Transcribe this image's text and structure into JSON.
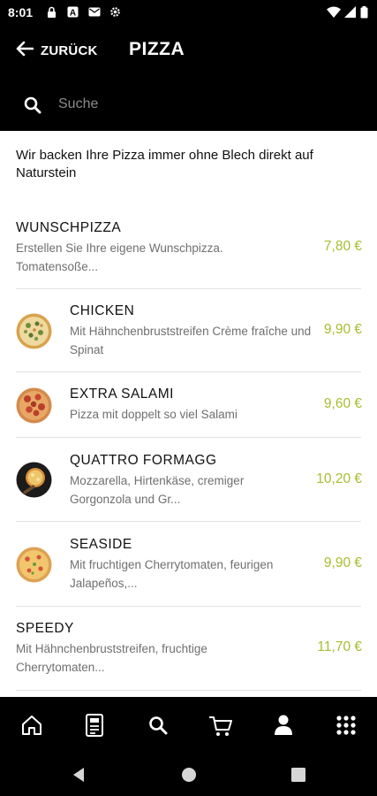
{
  "status_bar": {
    "time": "8:01",
    "left_icons": [
      "lock-icon",
      "a-icon",
      "mail-icon",
      "settings-icon"
    ],
    "right_icons": [
      "wifi-icon",
      "signal-icon",
      "battery-icon"
    ]
  },
  "header": {
    "back_label": "ZURÜCK",
    "title": "PIZZA"
  },
  "search": {
    "placeholder": "Suche"
  },
  "intro_text": "Wir backen Ihre Pizza immer ohne Blech direkt auf Naturstein",
  "items": [
    {
      "name": "WUNSCHPIZZA",
      "description": "Erstellen Sie Ihre eigene Wunschpizza. Tomatensoße...",
      "price": "7,80 €",
      "has_image": false
    },
    {
      "name": "CHICKEN",
      "description": "Mit Hähnchenbruststreifen Crème fraîche und Spinat",
      "price": "9,90 €",
      "has_image": true
    },
    {
      "name": "EXTRA SALAMI",
      "description": "Pizza mit doppelt so viel Salami",
      "price": "9,60 €",
      "has_image": true
    },
    {
      "name": "QUATTRO FORMAGG",
      "description": "Mozzarella, Hirtenkäse, cremiger Gorgonzola und Gr...",
      "price": "10,20 €",
      "has_image": true
    },
    {
      "name": "SEASIDE",
      "description": "Mit fruchtigen Cherrytomaten, feurigen Jalapeños,...",
      "price": "9,90 €",
      "has_image": true
    },
    {
      "name": "SPEEDY",
      "description": "Mit Hähnchenbruststreifen, fruchtige Cherrytomaten...",
      "price": "11,70 €",
      "has_image": false
    }
  ],
  "bottom_nav": [
    "home-icon",
    "menu-card-icon",
    "search-icon",
    "cart-icon",
    "user-icon",
    "grid-icon"
  ],
  "colors": {
    "price": "#a6be2f",
    "background_dark": "#000000",
    "background_light": "#ffffff",
    "text_secondary": "#6f6f6f"
  }
}
